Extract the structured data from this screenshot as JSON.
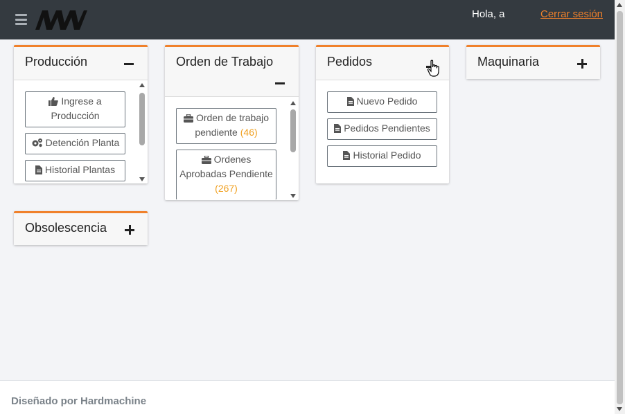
{
  "header": {
    "greeting": "Hola, a",
    "logout_label": "Cerrar sesión"
  },
  "colors": {
    "accent": "#f0812b",
    "topbar": "#343a40",
    "count": "#f0a020"
  },
  "cards": {
    "produccion": {
      "title": "Producción",
      "state": "expanded",
      "buttons": [
        {
          "label": "Ingrese a Producción",
          "icon": "thumbs-up-icon"
        },
        {
          "label": "Detención Planta",
          "icon": "cogs-icon"
        },
        {
          "label": "Historial Plantas",
          "icon": "file-icon"
        }
      ]
    },
    "orden": {
      "title": "Orden de Trabajo",
      "state": "expanded",
      "buttons": [
        {
          "label": "Orden de trabajo pendiente",
          "count": "(46)",
          "icon": "briefcase-icon"
        },
        {
          "label": "Ordenes Aprobadas Pendiente",
          "count": "(267)",
          "icon": "briefcase-icon"
        }
      ]
    },
    "pedidos": {
      "title": "Pedidos",
      "state": "expanded",
      "buttons": [
        {
          "label": "Nuevo Pedido",
          "icon": "file-icon"
        },
        {
          "label": "Pedidos Pendientes",
          "icon": "file-icon"
        },
        {
          "label": "Historial Pedido",
          "icon": "file-icon"
        }
      ]
    },
    "maquinaria": {
      "title": "Maquinaria",
      "state": "collapsed"
    },
    "obsolescencia": {
      "title": "Obsolescencia",
      "state": "collapsed"
    }
  },
  "footer": {
    "text": "Diseñado por Hardmachine"
  }
}
